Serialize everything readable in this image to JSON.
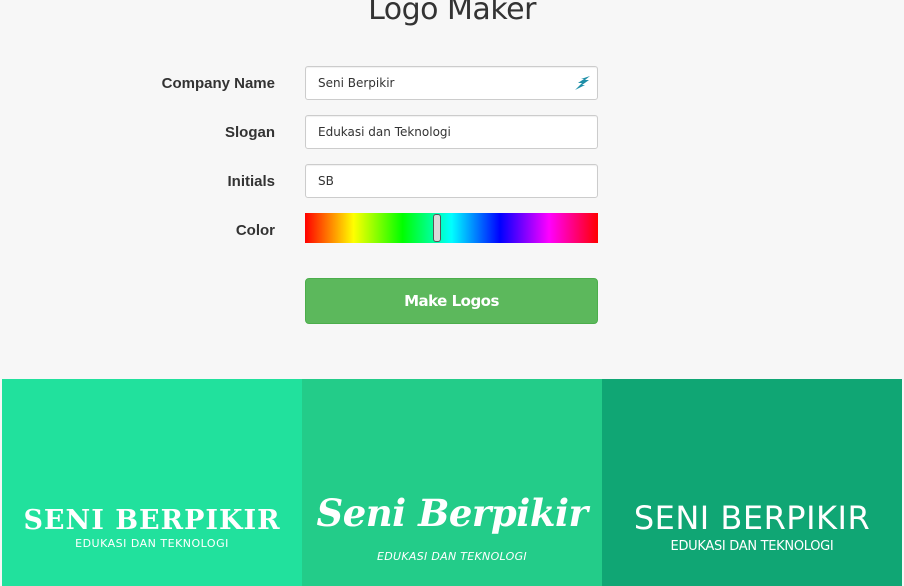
{
  "page": {
    "title": "Logo Maker"
  },
  "form": {
    "company_label": "Company Name",
    "company_value": "Seni Berpikir",
    "slogan_label": "Slogan",
    "slogan_value": "Edukasi dan Teknologi",
    "initials_label": "Initials",
    "initials_value": "SB",
    "color_label": "Color",
    "color_hue_fraction": 0.45,
    "submit_label": "Make Logos"
  },
  "logos": [
    {
      "name": "SENI BERPIKIR",
      "slogan": "EDUKASI DAN TEKNOLOGI",
      "background": "#21e19d"
    },
    {
      "name": "Seni Berpikir",
      "slogan": "EDUKASI DAN TEKNOLOGI",
      "background": "#23cc89"
    },
    {
      "name": "SENI BERPIKIR",
      "slogan": "EDUKASI DAN TEKNOLOGI",
      "background": "#10a674"
    }
  ],
  "colors": {
    "button": "#5cb85c",
    "page_background": "#f7f7f7"
  },
  "icons": {
    "company_field_icon": "bird-icon"
  }
}
